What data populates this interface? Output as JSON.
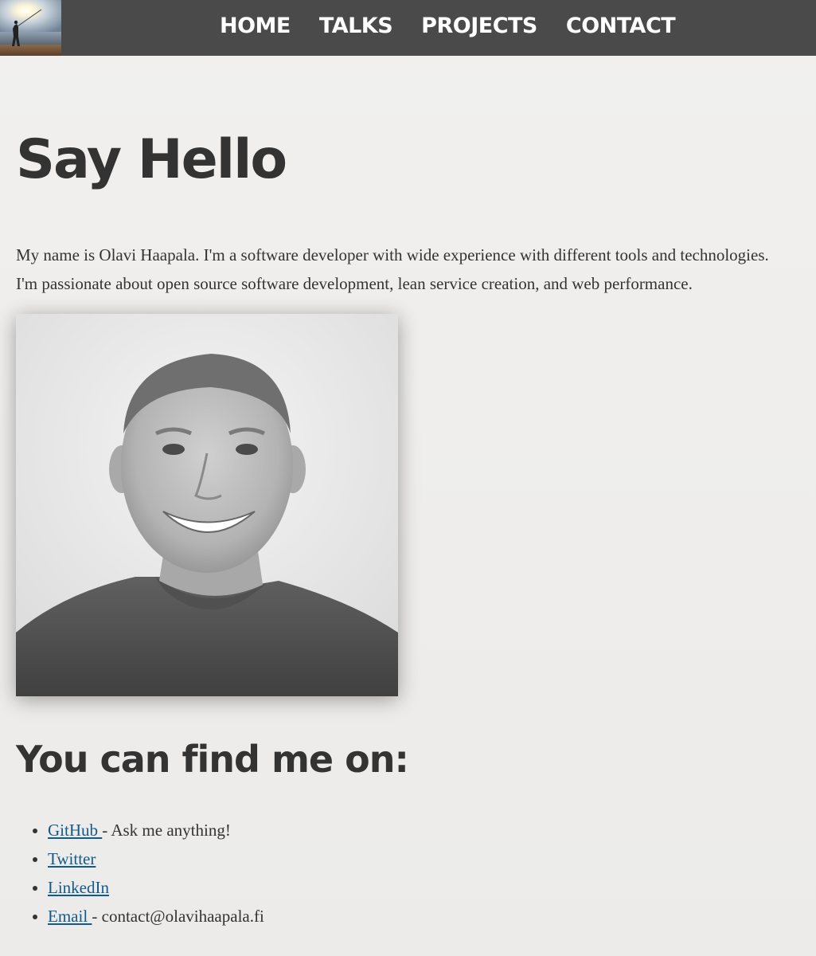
{
  "nav": {
    "items": [
      {
        "label": "HOME"
      },
      {
        "label": "TALKS"
      },
      {
        "label": "PROJECTS"
      },
      {
        "label": "CONTACT"
      }
    ]
  },
  "hero": {
    "title": "Say Hello",
    "intro": "My name is Olavi Haapala. I'm a software developer with wide experience with different tools and technologies. I'm passionate about open source software development, lean service creation, and web performance."
  },
  "find": {
    "title": "You can find me on:",
    "links": [
      {
        "label": "GitHub ",
        "suffix": "- Ask me anything!"
      },
      {
        "label": "Twitter",
        "suffix": ""
      },
      {
        "label": "LinkedIn",
        "suffix": ""
      },
      {
        "label": "Email ",
        "suffix": "- contact@olavihaapala.fi"
      }
    ]
  },
  "colors": {
    "topbar": "#4a4a4a",
    "link": "#135a8c",
    "text": "#333333",
    "background": "#f0efed"
  },
  "icons": [
    "logo-sunset-fisherman-image",
    "profile-photo-image"
  ]
}
